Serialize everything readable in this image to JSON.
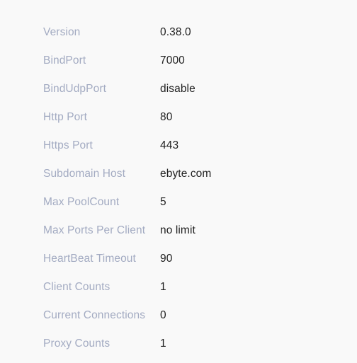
{
  "panel": {
    "name": "frp-server-dashboard-info",
    "background_color": "#f9f9f9",
    "label_color": "#a3abc2",
    "value_color": "#1f1f1f"
  },
  "rows": [
    {
      "label": "Version",
      "value": "0.38.0"
    },
    {
      "label": "BindPort",
      "value": "7000"
    },
    {
      "label": "BindUdpPort",
      "value": "disable"
    },
    {
      "label": "Http Port",
      "value": "80"
    },
    {
      "label": "Https Port",
      "value": "443"
    },
    {
      "label": "Subdomain Host",
      "value": "ebyte.com"
    },
    {
      "label": "Max PoolCount",
      "value": "5"
    },
    {
      "label": "Max Ports Per Client",
      "value": "no limit"
    },
    {
      "label": "HeartBeat Timeout",
      "value": "90"
    },
    {
      "label": "Client Counts",
      "value": "1"
    },
    {
      "label": "Current Connections",
      "value": "0"
    },
    {
      "label": "Proxy Counts",
      "value": "1"
    }
  ]
}
